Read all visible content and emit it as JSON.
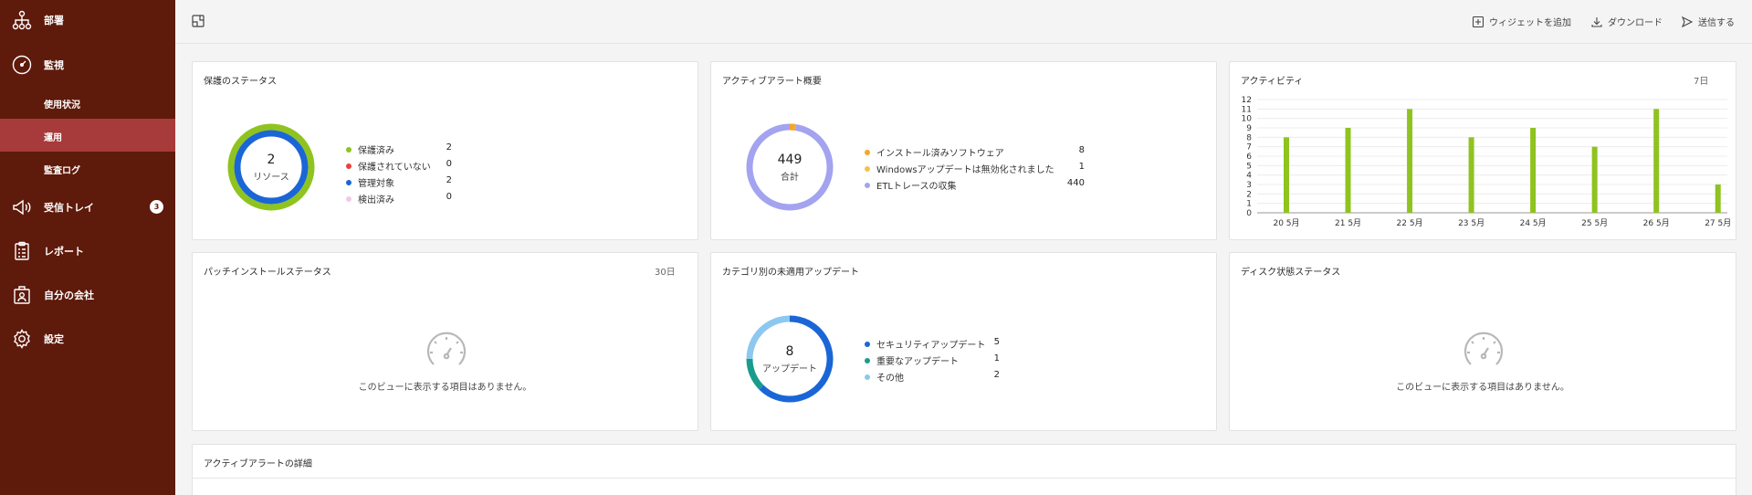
{
  "sidebar": {
    "items": [
      {
        "label": "部署",
        "icon": "org-chart-icon"
      },
      {
        "label": "監視",
        "icon": "gauge-icon"
      },
      {
        "label": "受信トレイ",
        "icon": "megaphone-icon",
        "badge": "3"
      },
      {
        "label": "レポート",
        "icon": "clipboard-icon"
      },
      {
        "label": "自分の会社",
        "icon": "company-icon"
      },
      {
        "label": "設定",
        "icon": "gear-icon"
      }
    ],
    "sub_items": [
      {
        "label": "使用状況",
        "active": false
      },
      {
        "label": "運用",
        "active": true
      },
      {
        "label": "監査ログ",
        "active": false
      }
    ]
  },
  "topbar": {
    "add_widget": "ウィジェットを追加",
    "download": "ダウンロード",
    "send": "送信する"
  },
  "protection": {
    "title": "保護のステータス",
    "center_value": "2",
    "center_label": "リソース",
    "legend": [
      {
        "label": "保護済み",
        "value": "2",
        "color": "#8fc31f"
      },
      {
        "label": "保護されていない",
        "value": "0",
        "color": "#e8423b"
      },
      {
        "label": "管理対象",
        "value": "2",
        "color": "#1a66d6"
      },
      {
        "label": "検出済み",
        "value": "0",
        "color": "#f2c9e8"
      }
    ]
  },
  "alerts_overview": {
    "title": "アクティブアラート概要",
    "center_value": "449",
    "center_label": "合計",
    "legend": [
      {
        "label": "インストール済みソフトウェア",
        "value": "8",
        "color": "#f5a623"
      },
      {
        "label": "Windowsアップデートは無効化されました",
        "value": "1",
        "color": "#f2c14e"
      },
      {
        "label": "ETLトレースの収集",
        "value": "440",
        "color": "#a3a3f0"
      }
    ]
  },
  "activity": {
    "title": "アクティビティ",
    "period": "7日"
  },
  "chart_data": {
    "type": "bar",
    "categories": [
      "20 5月",
      "21 5月",
      "22 5月",
      "23 5月",
      "24 5月",
      "25 5月",
      "26 5月",
      "27 5月"
    ],
    "values": [
      8,
      9,
      11,
      8,
      9,
      7,
      11,
      3
    ],
    "ylim": [
      0,
      12
    ],
    "yticks": [
      0,
      1,
      2,
      3,
      4,
      5,
      6,
      7,
      8,
      9,
      10,
      11,
      12
    ],
    "color": "#8fc31f",
    "grid": true
  },
  "patch_install": {
    "title": "パッチインストールステータス",
    "period": "30日",
    "empty": "このビューに表示する項目はありません。"
  },
  "missing_updates": {
    "title": "カテゴリ別の未適用アップデート",
    "center_value": "8",
    "center_label": "アップデート",
    "legend": [
      {
        "label": "セキュリティアップデート",
        "value": "5",
        "color": "#1a66d6"
      },
      {
        "label": "重要なアップデート",
        "value": "1",
        "color": "#1a9c8c"
      },
      {
        "label": "その他",
        "value": "2",
        "color": "#8cc8f0"
      }
    ]
  },
  "disk_status": {
    "title": "ディスク状態ステータス",
    "empty": "このビューに表示する項目はありません。"
  },
  "alert_details": {
    "title": "アクティブアラートの詳細"
  }
}
